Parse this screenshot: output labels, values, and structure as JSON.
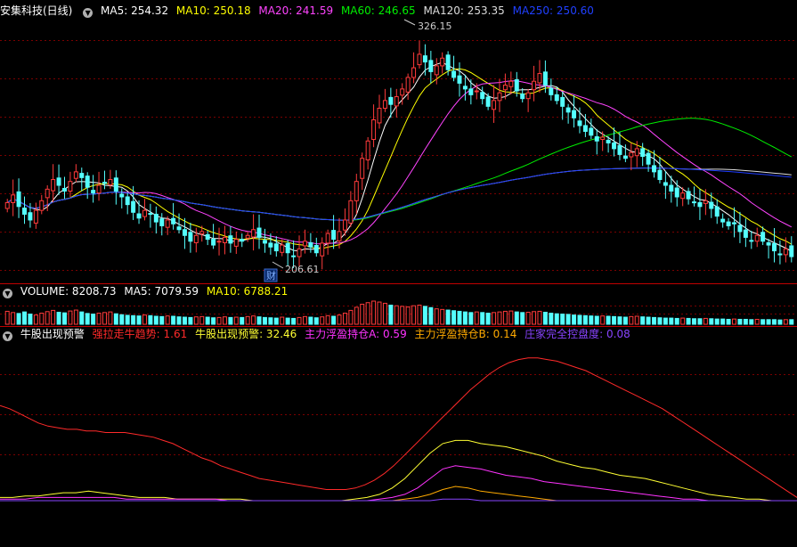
{
  "header": {
    "stock_title": "安集科技(日线)",
    "ma5": "MA5: 254.32",
    "ma10": "MA10: 250.18",
    "ma20": "MA20: 241.59",
    "ma60": "MA60: 246.65",
    "ma120": "MA120: 253.35",
    "ma250": "MA250: 250.60"
  },
  "price_annotations": {
    "high": "326.15",
    "low": "206.61",
    "finance_marker": "财"
  },
  "volume_header": {
    "title": "VOLUME: 8208.73",
    "ma5": "MA5: 7079.59",
    "ma10": "MA10: 6788.21"
  },
  "indicator_header": {
    "title": "牛股出现预警",
    "v1": "强拉走牛趋势: 1.61",
    "v2": "牛股出现预警: 32.46",
    "v3": "主力浮盈持仓A: 0.59",
    "v4": "主力浮盈持仓B: 0.14",
    "v5": "庄家完全控盘度: 0.08"
  },
  "colors": {
    "up": "#ff3b3b",
    "down": "#54ffff",
    "ma5": "#ffffff",
    "ma10": "#ffff00",
    "ma20": "#ff44ff",
    "ma60": "#00ee00",
    "ma120": "#dddddd",
    "ma250": "#1e3cff",
    "grid": "#7a0000",
    "divider": "#c00000",
    "ind1": "#ff2a2a",
    "ind2": "#ffff33",
    "ind3": "#ff33ff",
    "ind4": "#ffaa00",
    "ind5": "#8844ff"
  },
  "chart_data": {
    "type": "candlestick",
    "price_range": [
      200,
      335
    ],
    "indicator_range": [
      0,
      100
    ],
    "closes": [
      240,
      244,
      238,
      234,
      231,
      236,
      241,
      247,
      252,
      249,
      246,
      251,
      256,
      253,
      248,
      245,
      249,
      250,
      252,
      246,
      243,
      239,
      235,
      232,
      236,
      234,
      230,
      228,
      231,
      229,
      226,
      223,
      220,
      223,
      225,
      221,
      218,
      220,
      222,
      219,
      221,
      220,
      223,
      226,
      222,
      219,
      217,
      215,
      218,
      214,
      212,
      216,
      220,
      217,
      214,
      219,
      224,
      221,
      225,
      231,
      241,
      251,
      263,
      272,
      283,
      289,
      293,
      291,
      295,
      299,
      305,
      310,
      317,
      313,
      308,
      311,
      315,
      309,
      305,
      302,
      299,
      296,
      298,
      294,
      290,
      293,
      297,
      301,
      303,
      298,
      294,
      297,
      303,
      307,
      301,
      296,
      293,
      290,
      287,
      284,
      280,
      277,
      275,
      272,
      274,
      271,
      268,
      265,
      263,
      266,
      268,
      264,
      260,
      256,
      252,
      249,
      246,
      243,
      245,
      242,
      240,
      238,
      241,
      237,
      233,
      230,
      228,
      229,
      225,
      222,
      220,
      223,
      220,
      218,
      215,
      213,
      216,
      212
    ],
    "volume": [
      42,
      38,
      35,
      40,
      33,
      30,
      36,
      41,
      45,
      39,
      37,
      43,
      46,
      40,
      35,
      33,
      36,
      38,
      40,
      34,
      31,
      29,
      28,
      27,
      30,
      28,
      26,
      25,
      27,
      26,
      24,
      23,
      22,
      24,
      25,
      23,
      21,
      22,
      24,
      22,
      23,
      22,
      25,
      27,
      24,
      22,
      21,
      20,
      23,
      20,
      19,
      22,
      25,
      23,
      21,
      24,
      28,
      26,
      30,
      36,
      45,
      55,
      65,
      70,
      75,
      72,
      68,
      62,
      60,
      58,
      56,
      60,
      62,
      58,
      54,
      50,
      48,
      46,
      44,
      42,
      40,
      38,
      40,
      38,
      36,
      38,
      40,
      42,
      43,
      40,
      38,
      39,
      41,
      42,
      39,
      36,
      34,
      33,
      32,
      30,
      29,
      28,
      27,
      26,
      27,
      26,
      25,
      24,
      23,
      25,
      26,
      24,
      23,
      22,
      21,
      20,
      20,
      19,
      20,
      19,
      18,
      18,
      19,
      18,
      17,
      17,
      16,
      17,
      16,
      16,
      15,
      16,
      15,
      15,
      15,
      14,
      15,
      15
    ],
    "indicator": [
      [
        60,
        58,
        55,
        52,
        49,
        47,
        46,
        45,
        45,
        44,
        44,
        43,
        43,
        43,
        42,
        41,
        40,
        38,
        36,
        33,
        30,
        27,
        25,
        22,
        20,
        18,
        16,
        14,
        13,
        12,
        11,
        10,
        9,
        8,
        7,
        7,
        7,
        8,
        10,
        13,
        17,
        22,
        28,
        34,
        40,
        46,
        52,
        58,
        64,
        70,
        75,
        80,
        84,
        87,
        89,
        90,
        90,
        89,
        88,
        86,
        84,
        82,
        79,
        76,
        73,
        70,
        67,
        64,
        61,
        58,
        54,
        50,
        46,
        42,
        38,
        34,
        30,
        26,
        22,
        18,
        14,
        10,
        6,
        2
      ],
      [
        2,
        2,
        3,
        3,
        4,
        5,
        5,
        6,
        5,
        4,
        3,
        2,
        2,
        2,
        1,
        1,
        1,
        1,
        1,
        1,
        0,
        0,
        0,
        0,
        0,
        0,
        0,
        0,
        1,
        2,
        4,
        8,
        14,
        22,
        30,
        36,
        38,
        38,
        36,
        35,
        34,
        32,
        30,
        28,
        25,
        23,
        21,
        20,
        18,
        16,
        15,
        14,
        12,
        10,
        8,
        6,
        4,
        3,
        2,
        1,
        1,
        0,
        0,
        0
      ],
      [
        1,
        1,
        1,
        2,
        2,
        2,
        2,
        2,
        2,
        2,
        1,
        1,
        1,
        1,
        1,
        1,
        1,
        1,
        0,
        0,
        0,
        0,
        0,
        0,
        0,
        0,
        0,
        0,
        0,
        0,
        1,
        2,
        4,
        8,
        14,
        20,
        22,
        21,
        20,
        18,
        16,
        15,
        14,
        12,
        11,
        10,
        9,
        8,
        7,
        6,
        5,
        4,
        3,
        2,
        1,
        1,
        0,
        0,
        0,
        0,
        0,
        0,
        0,
        0
      ],
      [
        0,
        0,
        0,
        0,
        0,
        0,
        0,
        0,
        0,
        0,
        0,
        0,
        0,
        0,
        0,
        0,
        0,
        0,
        0,
        0,
        0,
        0,
        0,
        0,
        0,
        0,
        0,
        0,
        0,
        0,
        0,
        0,
        1,
        2,
        4,
        7,
        9,
        8,
        6,
        5,
        4,
        3,
        2,
        1,
        0,
        0,
        0,
        0,
        0,
        0,
        0,
        0,
        0,
        0,
        0,
        0,
        0,
        0,
        0,
        0,
        0,
        0,
        0,
        0
      ],
      [
        0,
        0,
        0,
        0,
        0,
        0,
        0,
        0,
        0,
        0,
        0,
        0,
        0,
        0,
        0,
        0,
        0,
        0,
        0,
        0,
        0,
        0,
        0,
        0,
        0,
        0,
        0,
        0,
        0,
        0,
        0,
        0,
        0,
        0,
        0,
        1,
        1,
        1,
        0,
        0,
        0,
        0,
        0,
        0,
        0,
        0,
        0,
        0,
        0,
        0,
        0,
        0,
        0,
        0,
        0,
        0,
        0,
        0,
        0,
        0,
        0,
        0,
        0,
        0
      ]
    ]
  }
}
